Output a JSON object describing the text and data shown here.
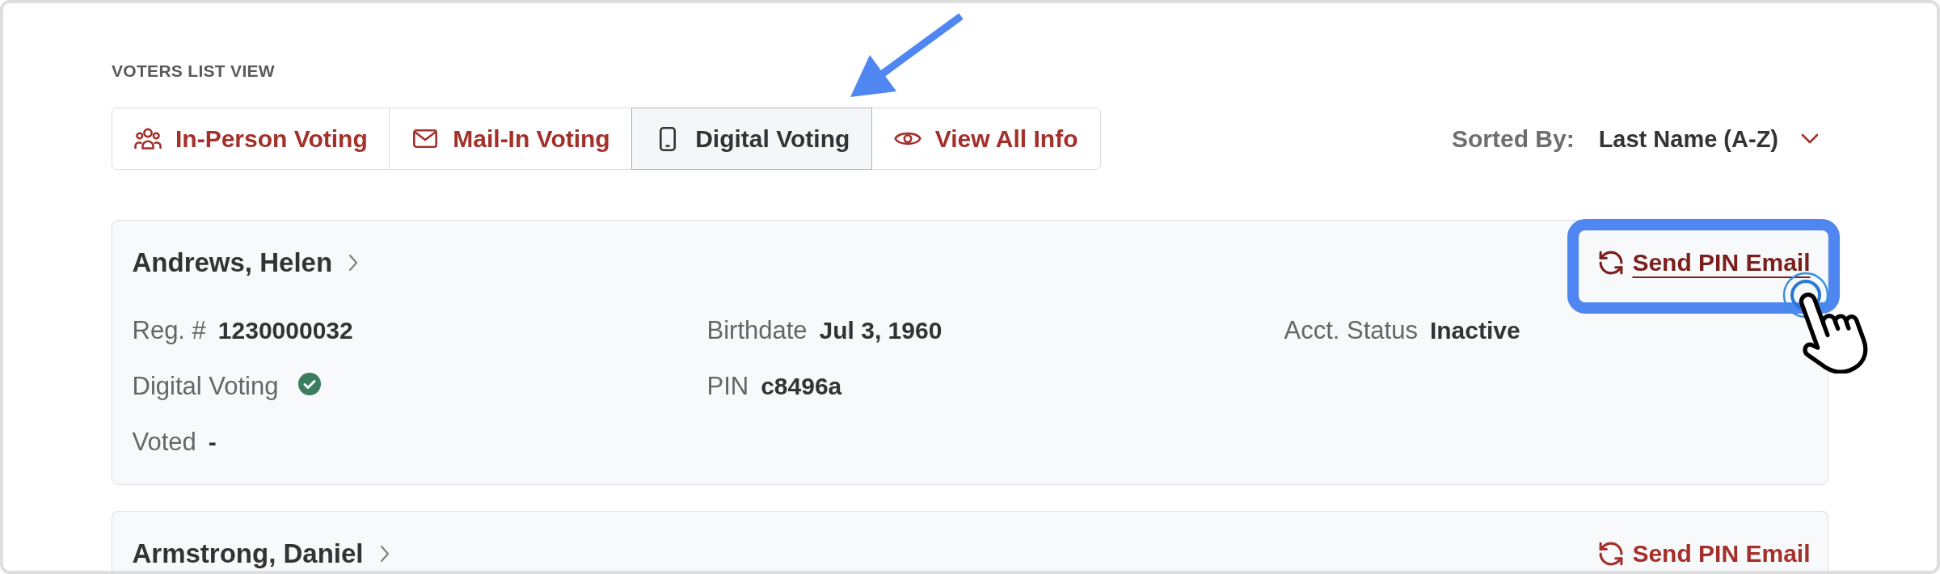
{
  "section_title": "VOTERS LIST VIEW",
  "tabs": [
    {
      "label": "In-Person Voting",
      "selected": false,
      "highlighted": false
    },
    {
      "label": "Mail-In Voting",
      "selected": false,
      "highlighted": false
    },
    {
      "label": "Digital Voting",
      "selected": true,
      "highlighted": true
    },
    {
      "label": "View All Info",
      "selected": false,
      "highlighted": false
    }
  ],
  "sort": {
    "label": "Sorted By:",
    "value": "Last Name (A-Z)"
  },
  "voters": [
    {
      "name": "Andrews, Helen",
      "action": {
        "label": "Send PIN Email",
        "highlighted": true
      },
      "rows": [
        [
          {
            "kind": "text",
            "label": "Reg. #",
            "value": "1230000032"
          },
          {
            "kind": "text",
            "label": "Birthdate",
            "value": "Jul 3, 1960"
          },
          {
            "kind": "text",
            "label": "Acct. Status",
            "value": "Inactive"
          }
        ],
        [
          {
            "kind": "check",
            "label": "Digital Voting",
            "checked": true
          },
          {
            "kind": "text",
            "label": "PIN",
            "value": "c8496a"
          }
        ],
        [
          {
            "kind": "text",
            "label": "Voted",
            "value": "-"
          }
        ]
      ]
    },
    {
      "name": "Armstrong, Daniel",
      "action": {
        "label": "Send PIN Email",
        "highlighted": false
      }
    }
  ]
}
